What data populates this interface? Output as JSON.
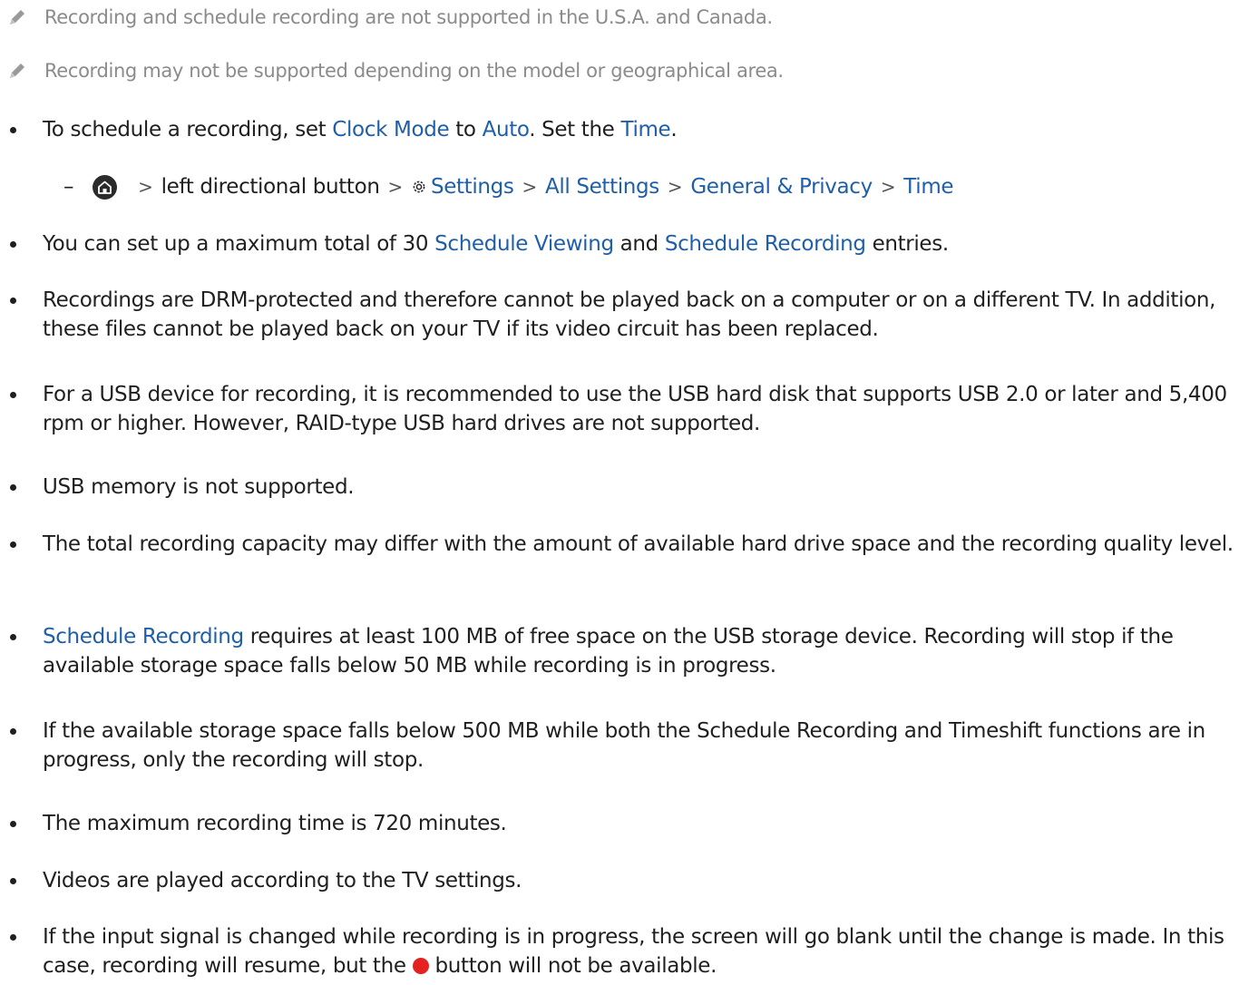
{
  "notes": [
    "Recording and schedule recording are not supported in the U.S.A. and Canada.",
    "Recording may not be supported depending on the model or geographical area."
  ],
  "b1": {
    "t1": "To schedule a recording, set ",
    "clock_mode": "Clock Mode",
    "t2": " to ",
    "auto": "Auto",
    "t3": ". Set the ",
    "time": "Time",
    "t4": "."
  },
  "path": {
    "dash": "–",
    "sep": ">",
    "left_button": "left directional button",
    "settings": "Settings",
    "all_settings": "All Settings",
    "general_privacy": "General & Privacy",
    "time": "Time"
  },
  "b2": {
    "t1": "You can set up a maximum total of 30 ",
    "schedule_viewing": "Schedule Viewing",
    "t2": " and ",
    "schedule_recording": "Schedule Recording",
    "t3": " entries."
  },
  "b3": "Recordings are DRM-protected and therefore cannot be played back on a computer or on a different TV. In addition, these files cannot be played back on your TV if its video circuit has been replaced.",
  "b4": "For a USB device for recording, it is recommended to use the USB hard disk that supports USB 2.0 or later and 5,400 rpm or higher. However, RAID-type USB hard drives are not supported.",
  "b5": "USB memory is not supported.",
  "b6": "The total recording capacity may differ with the amount of available hard drive space and the recording quality level.",
  "b7": {
    "schedule_recording": "Schedule Recording",
    "t1": " requires at least 100 MB of free space on the USB storage device. Recording will stop if the available storage space falls below 50 MB while recording is in progress."
  },
  "b8": "If the available storage space falls below 500 MB while both the Schedule Recording and Timeshift functions are in progress, only the recording will stop.",
  "b9": "The maximum recording time is 720 minutes.",
  "b10": "Videos are played according to the TV settings.",
  "b11": {
    "t1": "If the input signal is changed while recording is in progress, the screen will go blank until the change is made. In this case, recording will resume, but the ",
    "t2": " button will not be available."
  },
  "colors": {
    "link": "#1f5fa8",
    "note": "#8b8b8b",
    "text": "#1f1f1f",
    "record_button": "#e52222"
  },
  "icons": [
    "pencil-icon",
    "home-icon",
    "chevron-right-icon",
    "gear-icon",
    "record-button-icon"
  ]
}
